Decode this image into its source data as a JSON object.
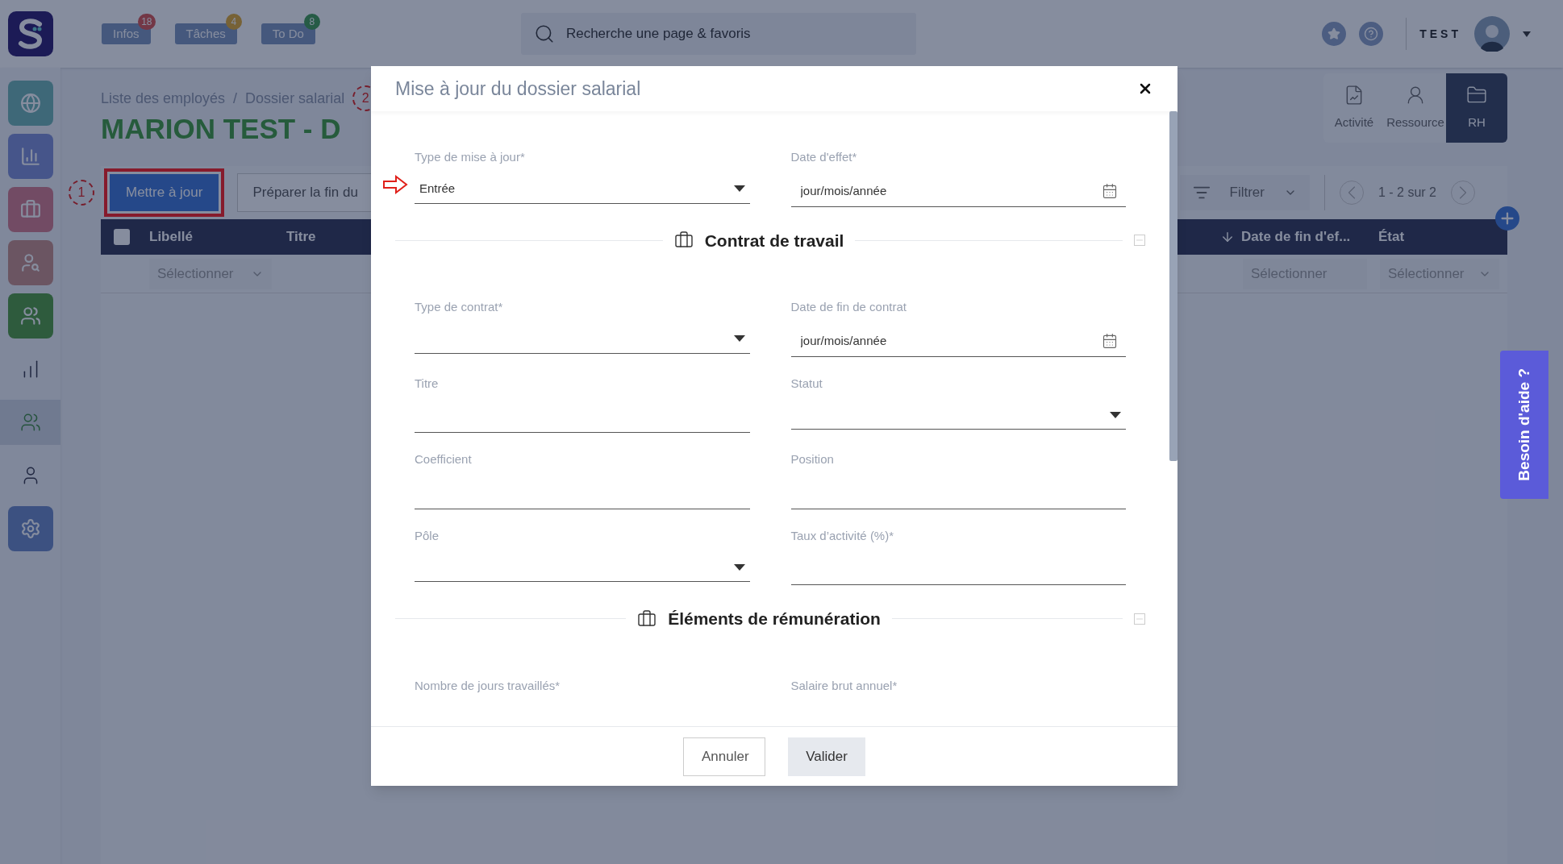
{
  "topbar": {
    "badges": [
      {
        "label": "Infos",
        "count": "18"
      },
      {
        "label": "Tâches",
        "count": "4"
      },
      {
        "label": "To Do",
        "count": "8"
      }
    ],
    "search": {
      "placeholder": "Recherche une page & favoris"
    },
    "user": "TEST"
  },
  "sidebar": {
    "items": [
      {
        "kind": "tile",
        "selected": false
      },
      {
        "kind": "tile",
        "selected": false
      },
      {
        "kind": "tile",
        "selected": false
      },
      {
        "kind": "tile",
        "selected": false
      },
      {
        "kind": "tile",
        "selected": false
      },
      {
        "kind": "plain",
        "selected": false
      },
      {
        "kind": "plain",
        "selected": true
      },
      {
        "kind": "plain",
        "selected": false
      },
      {
        "kind": "tile",
        "selected": false
      }
    ]
  },
  "breadcrumb": {
    "items": [
      "Liste des employés",
      "Dossier salarial"
    ],
    "separator": "/"
  },
  "title": "MARION TEST - D",
  "view_tabs": [
    {
      "label": "Activité",
      "selected": false
    },
    {
      "label": "Ressource",
      "selected": false
    },
    {
      "label": "RH",
      "selected": true
    }
  ],
  "toolbar": {
    "buttons": [
      {
        "label": "Mettre à jour",
        "kind": "primary",
        "highlighted": true
      },
      {
        "label": "Préparer la fin du",
        "kind": "secondary",
        "highlighted": false
      }
    ],
    "filter": "Filtrer",
    "pagination": "1 - 2 sur 2"
  },
  "table": {
    "select_all_checked": false,
    "columns_left": [
      "Libellé",
      "Titre"
    ],
    "columns_right": [
      "Date de fin d'ef...",
      "État"
    ],
    "filters_left": [
      "Sélectionner"
    ],
    "filters_right": [
      "Sélectionner",
      "Sélectionner"
    ]
  },
  "annotations": [
    "1",
    "2"
  ],
  "help": "Besoin d'aide ?",
  "modal": {
    "title": "Mise à jour du dossier salarial",
    "blocks": [
      {
        "kind": "fields",
        "fields": [
          {
            "label": "Type de mise à jour*",
            "kind": "select",
            "value": "Entrée"
          },
          {
            "label": "Date d'effet*",
            "kind": "date",
            "placeholder": "jour/mois/année"
          }
        ]
      },
      {
        "kind": "section",
        "title": "Contrat de travail"
      },
      {
        "kind": "fields",
        "fields": [
          {
            "label": "Type de contrat*",
            "kind": "select"
          },
          {
            "label": "Date de fin de contrat",
            "kind": "date",
            "placeholder": "jour/mois/année"
          }
        ]
      },
      {
        "kind": "fields",
        "fields": [
          {
            "label": "Titre",
            "kind": "text"
          },
          {
            "label": "Statut",
            "kind": "select"
          }
        ]
      },
      {
        "kind": "fields",
        "fields": [
          {
            "label": "Coefficient",
            "kind": "text"
          },
          {
            "label": "Position",
            "kind": "text"
          }
        ]
      },
      {
        "kind": "fields",
        "fields": [
          {
            "label": "Pôle",
            "kind": "select"
          },
          {
            "label": "Taux d’activité (%)*",
            "kind": "text"
          }
        ]
      },
      {
        "kind": "section",
        "title": "Éléments de rémunération"
      },
      {
        "kind": "labels",
        "fields": [
          {
            "label": "Nombre de jours travaillés*"
          },
          {
            "label": "Salaire brut annuel*"
          }
        ]
      }
    ],
    "buttons": [
      {
        "label": "Annuler",
        "kind": "secondary"
      },
      {
        "label": "Valider",
        "kind": "primary"
      }
    ]
  }
}
